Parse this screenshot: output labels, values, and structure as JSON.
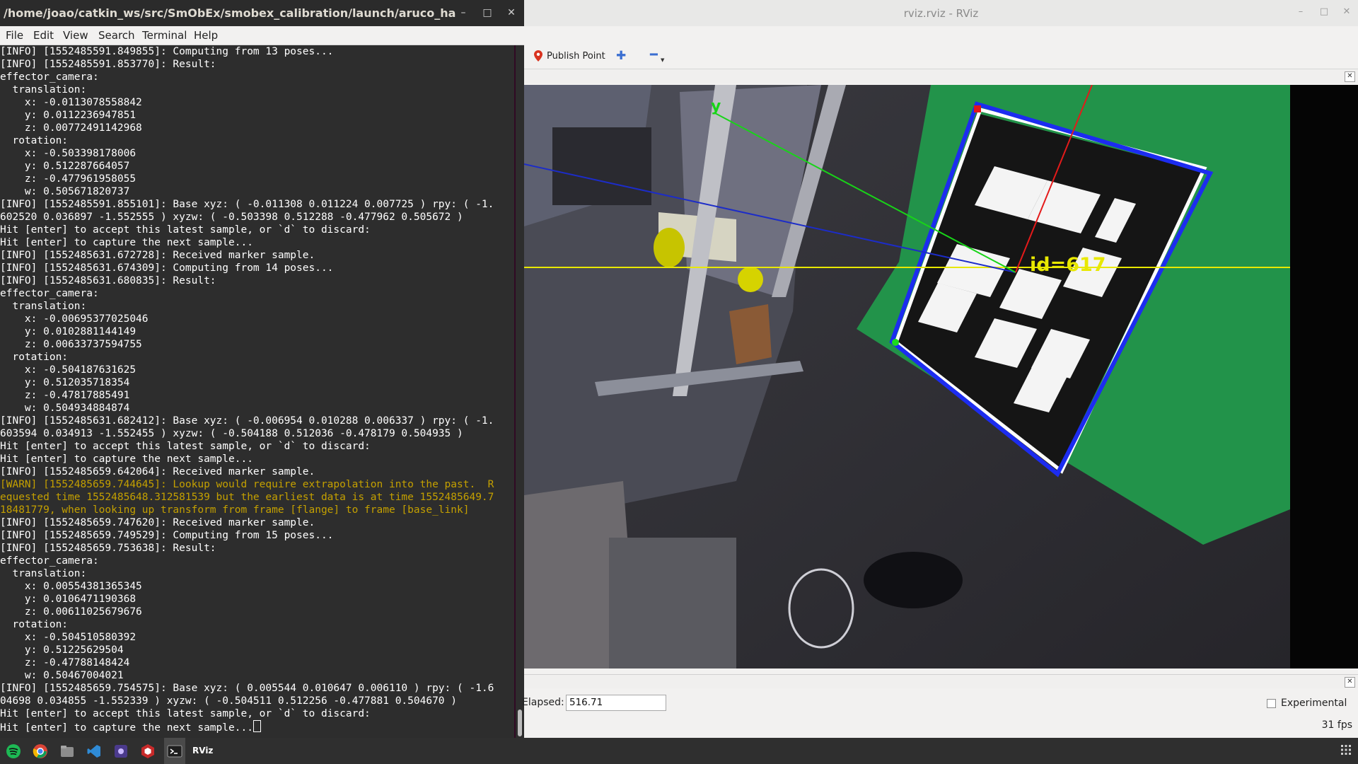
{
  "terminal": {
    "title": "/home/joao/catkin_ws/src/SmObEx/smobex_calibration/launch/aruco_hand_in_eye.laun...",
    "window_buttons": [
      "–",
      "□",
      "✕"
    ],
    "menu": [
      "File",
      "Edit",
      "View",
      "Search",
      "Terminal",
      "Help"
    ],
    "lines": [
      {
        "text": "[INFO] [1552485591.849855]: Computing from 13 poses...",
        "level": "info"
      },
      {
        "text": "[INFO] [1552485591.853770]: Result:",
        "level": "info"
      },
      {
        "text": "effector_camera:",
        "level": "info"
      },
      {
        "text": "  translation:",
        "level": "info"
      },
      {
        "text": "    x: -0.0113078558842",
        "level": "info"
      },
      {
        "text": "    y: 0.0112236947851",
        "level": "info"
      },
      {
        "text": "    z: 0.00772491142968",
        "level": "info"
      },
      {
        "text": "  rotation:",
        "level": "info"
      },
      {
        "text": "    x: -0.503398178006",
        "level": "info"
      },
      {
        "text": "    y: 0.512287664057",
        "level": "info"
      },
      {
        "text": "    z: -0.477961958055",
        "level": "info"
      },
      {
        "text": "    w: 0.505671820737",
        "level": "info"
      },
      {
        "text": "[INFO] [1552485591.855101]: Base xyz: ( -0.011308 0.011224 0.007725 ) rpy: ( -1.",
        "level": "info"
      },
      {
        "text": "602520 0.036897 -1.552555 ) xyzw: ( -0.503398 0.512288 -0.477962 0.505672 )",
        "level": "info"
      },
      {
        "text": "Hit [enter] to accept this latest sample, or `d` to discard:",
        "level": "info"
      },
      {
        "text": "Hit [enter] to capture the next sample...",
        "level": "info"
      },
      {
        "text": "[INFO] [1552485631.672728]: Received marker sample.",
        "level": "info"
      },
      {
        "text": "[INFO] [1552485631.674309]: Computing from 14 poses...",
        "level": "info"
      },
      {
        "text": "[INFO] [1552485631.680835]: Result:",
        "level": "info"
      },
      {
        "text": "effector_camera:",
        "level": "info"
      },
      {
        "text": "  translation:",
        "level": "info"
      },
      {
        "text": "    x: -0.00695377025046",
        "level": "info"
      },
      {
        "text": "    y: 0.0102881144149",
        "level": "info"
      },
      {
        "text": "    z: 0.00633737594755",
        "level": "info"
      },
      {
        "text": "  rotation:",
        "level": "info"
      },
      {
        "text": "    x: -0.504187631625",
        "level": "info"
      },
      {
        "text": "    y: 0.512035718354",
        "level": "info"
      },
      {
        "text": "    z: -0.47817885491",
        "level": "info"
      },
      {
        "text": "    w: 0.504934884874",
        "level": "info"
      },
      {
        "text": "[INFO] [1552485631.682412]: Base xyz: ( -0.006954 0.010288 0.006337 ) rpy: ( -1.",
        "level": "info"
      },
      {
        "text": "603594 0.034913 -1.552455 ) xyzw: ( -0.504188 0.512036 -0.478179 0.504935 )",
        "level": "info"
      },
      {
        "text": "Hit [enter] to accept this latest sample, or `d` to discard:",
        "level": "info"
      },
      {
        "text": "Hit [enter] to capture the next sample...",
        "level": "info"
      },
      {
        "text": "[INFO] [1552485659.642064]: Received marker sample.",
        "level": "info"
      },
      {
        "text": "[WARN] [1552485659.744645]: Lookup would require extrapolation into the past.  R",
        "level": "warn"
      },
      {
        "text": "equested time 1552485648.312581539 but the earliest data is at time 1552485649.7",
        "level": "warn"
      },
      {
        "text": "18481779, when looking up transform from frame [flange] to frame [base_link]",
        "level": "warn"
      },
      {
        "text": "[INFO] [1552485659.747620]: Received marker sample.",
        "level": "info"
      },
      {
        "text": "[INFO] [1552485659.749529]: Computing from 15 poses...",
        "level": "info"
      },
      {
        "text": "[INFO] [1552485659.753638]: Result:",
        "level": "info"
      },
      {
        "text": "effector_camera:",
        "level": "info"
      },
      {
        "text": "  translation:",
        "level": "info"
      },
      {
        "text": "    x: 0.00554381365345",
        "level": "info"
      },
      {
        "text": "    y: 0.0106471190368",
        "level": "info"
      },
      {
        "text": "    z: 0.00611025679676",
        "level": "info"
      },
      {
        "text": "  rotation:",
        "level": "info"
      },
      {
        "text": "    x: -0.504510580392",
        "level": "info"
      },
      {
        "text": "    y: 0.51225629504",
        "level": "info"
      },
      {
        "text": "    z: -0.47788148424",
        "level": "info"
      },
      {
        "text": "    w: 0.50467004021",
        "level": "info"
      },
      {
        "text": "[INFO] [1552485659.754575]: Base xyz: ( 0.005544 0.010647 0.006110 ) rpy: ( -1.6",
        "level": "info"
      },
      {
        "text": "04698 0.034855 -1.552339 ) xyzw: ( -0.504511 0.512256 -0.477881 0.504670 )",
        "level": "info"
      },
      {
        "text": "Hit [enter] to accept this latest sample, or `d` to discard:",
        "level": "info"
      },
      {
        "text": "Hit [enter] to capture the next sample...",
        "level": "info",
        "cursor": true
      }
    ]
  },
  "rviz": {
    "title": "rviz.rviz - RViz",
    "window_buttons": [
      "–",
      "□",
      "✕"
    ],
    "toolbar": {
      "publish_point": "Publish Point"
    },
    "camera": {
      "marker_label": "id=617",
      "axis_label": "y"
    },
    "time_panel": {
      "elapsed_label": "Elapsed:",
      "elapsed_value": "516.71",
      "experimental_label": "Experimental",
      "experimental_checked": false,
      "fps": "31 fps"
    }
  },
  "taskbar": {
    "apps": [
      "spotify-icon",
      "chrome-icon",
      "files-icon",
      "vscode-icon",
      "app-icon",
      "red-app-icon",
      "terminal-icon",
      "rviz-icon"
    ],
    "rviz_label": "RViz"
  },
  "colors": {
    "terminal_bg": "#2d2d2d",
    "warn": "#c4a000",
    "marker_text": "#e8e800",
    "marker_outline": "#1c2cf0"
  }
}
